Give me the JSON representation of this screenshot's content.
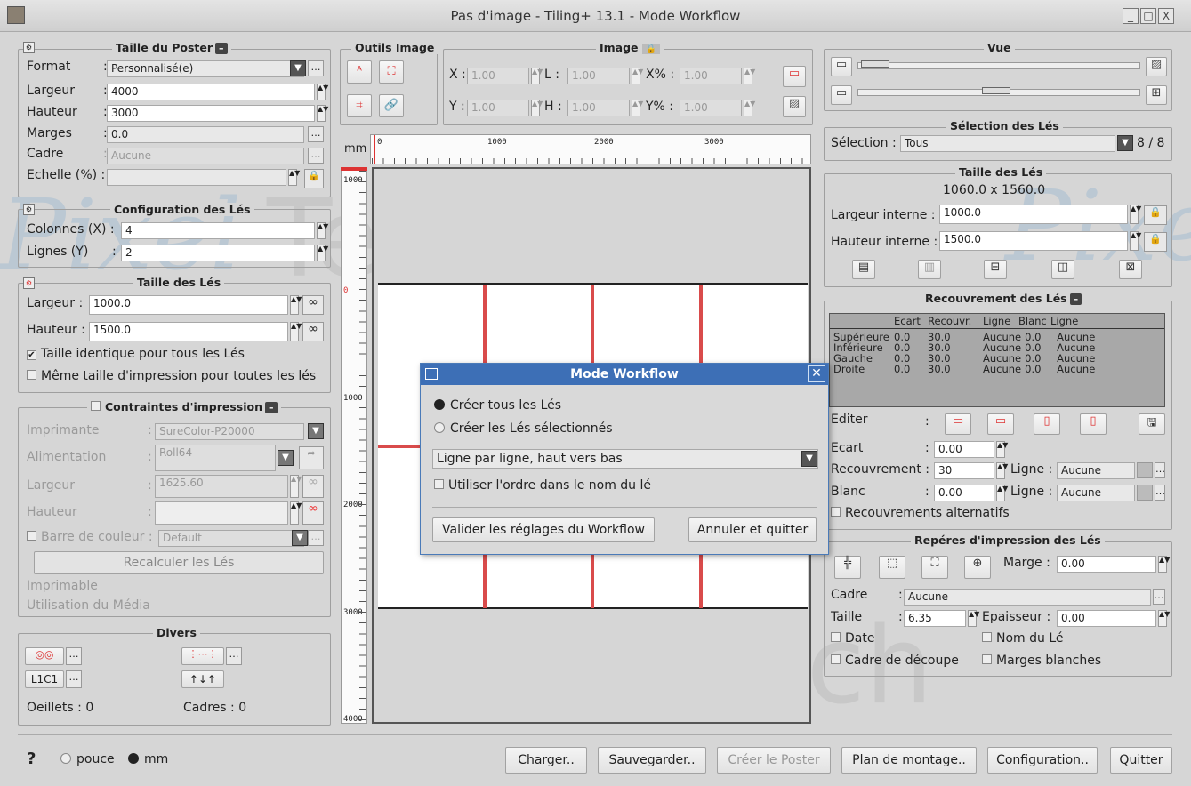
{
  "window": {
    "title": "Pas d'image - Tiling+ 13.1 - Mode Workflow",
    "min": "_",
    "max": "□",
    "close": "X"
  },
  "poster": {
    "title": "Taille du Poster",
    "format_label": "Format",
    "format_value": "Personnalisé(e)",
    "largeur_label": "Largeur",
    "largeur_value": "4000",
    "hauteur_label": "Hauteur",
    "hauteur_value": "3000",
    "marges_label": "Marges",
    "marges_value": "0.0",
    "cadre_label": "Cadre",
    "cadre_value": "Aucune",
    "echelle_label": "Echelle (%) :",
    "colon": ":"
  },
  "config": {
    "title": "Configuration des Lés",
    "col_label": "Colonnes (X) :",
    "col_value": "4",
    "lig_label": "Lignes (Y)",
    "lig_value": "2"
  },
  "tile_size": {
    "title": "Taille des Lés",
    "largeur_label": "Largeur :",
    "largeur_value": "1000.0",
    "hauteur_label": "Hauteur :",
    "hauteur_value": "1500.0",
    "same_size": "Taille identique pour tous les Lés",
    "same_print": "Même taille d'impression pour toutes les lés"
  },
  "print_constraints": {
    "title": "Contraintes d'impression",
    "imprimante_label": "Imprimante",
    "imprimante_value": "SureColor-P20000",
    "alimentation_label": "Alimentation",
    "alimentation_value": "Roll64",
    "largeur_label": "Largeur",
    "largeur_value": "1625.60",
    "hauteur_label": "Hauteur",
    "barre_label": "Barre de couleur :",
    "barre_value": "Default",
    "recalc": "Recalculer les Lés",
    "imprimable": "Imprimable",
    "utilisation": "Utilisation du Média"
  },
  "divers": {
    "title": "Divers",
    "l1c1": "L1C1",
    "oeillets": "Oeillets : 0",
    "cadres": "Cadres : 0"
  },
  "tools": {
    "title": "Outils Image"
  },
  "image": {
    "title": "Image",
    "x_label": "X :",
    "x_value": "1.00",
    "l_label": "L :",
    "l_value": "1.00",
    "xp_label": "X% :",
    "xp_value": "1.00",
    "y_label": "Y :",
    "y_value": "1.00",
    "h_label": "H :",
    "h_value": "1.00",
    "yp_label": "Y% :",
    "yp_value": "1.00"
  },
  "ruler": {
    "unit": "mm",
    "h_ticks": [
      "0",
      "1000",
      "2000",
      "3000"
    ],
    "v_ticks": [
      "1000",
      "0",
      "1000",
      "2000",
      "3000",
      "4000"
    ]
  },
  "vue": {
    "title": "Vue"
  },
  "selection": {
    "title": "Sélection des Lés",
    "label": "Sélection :",
    "value": "Tous",
    "count": "8 / 8"
  },
  "right_tile": {
    "title": "Taille des Lés",
    "dims": "1060.0 x 1560.0",
    "li_label": "Largeur interne :",
    "li_value": "1000.0",
    "hi_label": "Hauteur interne :",
    "hi_value": "1500.0"
  },
  "overlap": {
    "title": "Recouvrement des Lés",
    "headers": [
      "",
      "Ecart",
      "Recouvr.",
      "Ligne",
      "Blanc",
      "Ligne"
    ],
    "rows": [
      [
        "Supérieure",
        "0.0",
        "30.0",
        "Aucune",
        "0.0",
        "Aucune"
      ],
      [
        "Inférieure",
        "0.0",
        "30.0",
        "Aucune",
        "0.0",
        "Aucune"
      ],
      [
        "Gauche",
        "0.0",
        "30.0",
        "Aucune",
        "0.0",
        "Aucune"
      ],
      [
        "Droite",
        "0.0",
        "30.0",
        "Aucune",
        "0.0",
        "Aucune"
      ]
    ],
    "editer": "Editer",
    "ecart_label": "Ecart",
    "ecart_value": "0.00",
    "recouv_label": "Recouvrement :",
    "recouv_value": "30",
    "ligne_label": "Ligne :",
    "ligne_value": "Aucune",
    "blanc_label": "Blanc",
    "blanc_value": "0.00",
    "ligne2_value": "Aucune",
    "alt": "Recouvrements alternatifs",
    "colon": ":"
  },
  "marks": {
    "title": "Repéres d'impression des Lés",
    "marge_label": "Marge :",
    "marge_value": "0.00",
    "cadre_label": "Cadre",
    "cadre_value": "Aucune",
    "taille_label": "Taille",
    "taille_value": "6.35",
    "epaisseur_label": "Epaisseur :",
    "epaisseur_value": "0.00",
    "date": "Date",
    "nom": "Nom du Lé",
    "decoupe": "Cadre de découpe",
    "blanches": "Marges blanches"
  },
  "dialog": {
    "title": "Mode Workflow",
    "opt1": "Créer tous les Lés",
    "opt2": "Créer les Lés sélectionnés",
    "order": "Ligne par ligne, haut vers bas",
    "use_name": "Utiliser l'ordre dans le nom du lé",
    "validate": "Valider les réglages du Workflow",
    "cancel": "Annuler et quitter"
  },
  "bottom": {
    "help": "?",
    "pouce": "pouce",
    "mm": "mm",
    "charger": "Charger..",
    "sauvegarder": "Sauvegarder..",
    "creer": "Créer le Poster",
    "plan": "Plan de montage..",
    "config": "Configuration..",
    "quitter": "Quitter"
  },
  "watermark": {
    "text1": "Pixel",
    "text2": "Tech"
  }
}
